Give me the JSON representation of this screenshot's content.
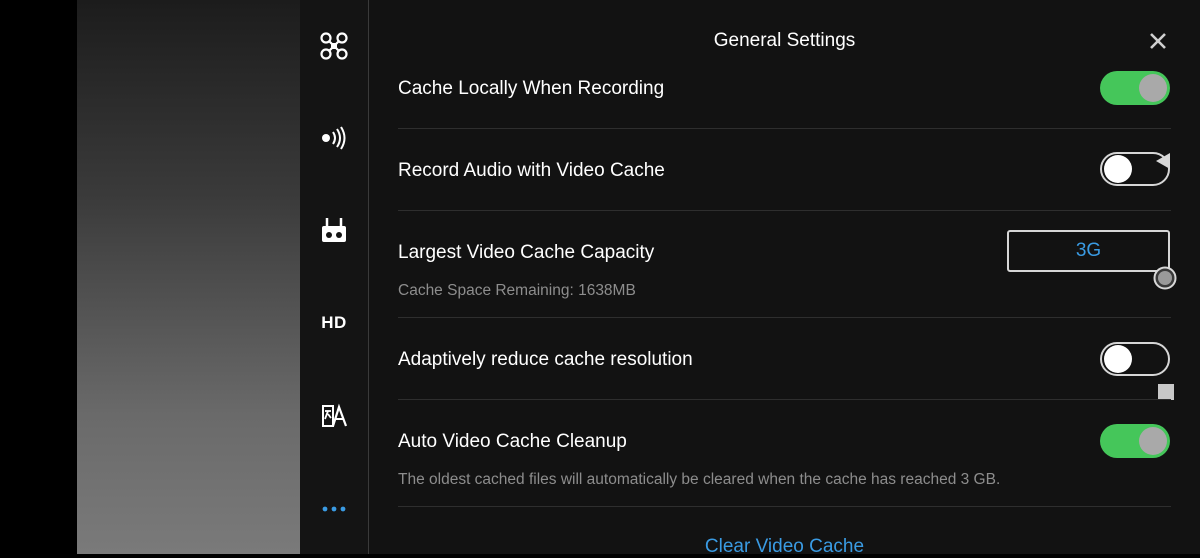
{
  "header": {
    "title": "General Settings"
  },
  "sidebar": {
    "items": [
      {
        "icon": "drone-icon"
      },
      {
        "icon": "signal-icon"
      },
      {
        "icon": "remote-controller-icon"
      },
      {
        "icon": "hd-icon",
        "label": "HD"
      },
      {
        "icon": "translate-icon"
      },
      {
        "icon": "more-icon"
      }
    ]
  },
  "settings": {
    "cache_locally": {
      "label": "Cache Locally When Recording",
      "enabled": true
    },
    "record_audio": {
      "label": "Record Audio with Video Cache",
      "enabled": false
    },
    "largest_capacity": {
      "label": "Largest Video Cache Capacity",
      "value": "3G",
      "sub": "Cache Space Remaining: 1638MB"
    },
    "adaptive_reduce": {
      "label": "Adaptively reduce cache resolution",
      "enabled": false
    },
    "auto_cleanup": {
      "label": "Auto Video Cache Cleanup",
      "enabled": true,
      "sub": "The oldest cached files will automatically be cleared when the cache has reached 3 GB."
    }
  },
  "clear_cache": {
    "label": "Clear Video Cache"
  },
  "colors": {
    "accent": "#3a9be3",
    "toggle_on": "#45c65a",
    "panel_bg": "#121212"
  }
}
